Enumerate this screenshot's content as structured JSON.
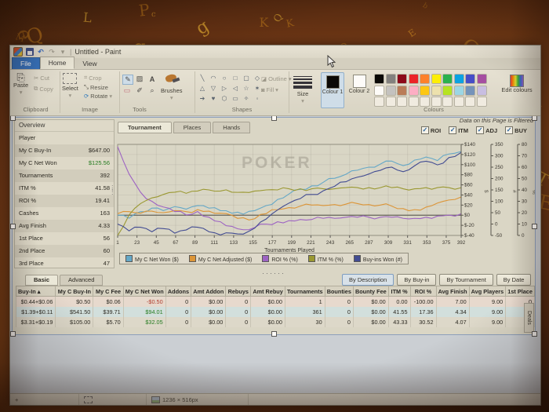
{
  "wallpaper": {
    "letters": "aQbjREsTuVwXyZkLmNoPdFgHiJcK3e97BDGMWqrzABCdefgHIJ"
  },
  "paint": {
    "title": "Untitled - Paint",
    "tabs": [
      "File",
      "Home",
      "View"
    ],
    "ribbon": {
      "clipboard": {
        "label": "Clipboard",
        "paste": "Paste",
        "cut": "Cut",
        "copy": "Copy"
      },
      "image": {
        "label": "Image",
        "select": "Select",
        "crop": "Crop",
        "resize": "Resize",
        "rotate": "Rotate"
      },
      "tools": {
        "label": "Tools",
        "brushes": "Brushes"
      },
      "shapes": {
        "label": "Shapes",
        "outline": "Outline",
        "fill": "Fill"
      },
      "size_label": "Size",
      "colours": {
        "label": "Colours",
        "colour1": "Colour 1",
        "colour2": "Colour 2",
        "edit": "Edit colours",
        "palette_row1": [
          "#000000",
          "#7f7f7f",
          "#880015",
          "#ed1c24",
          "#ff7f27",
          "#fff200",
          "#22b14c",
          "#00a2e8",
          "#3f48cc",
          "#a349a4"
        ],
        "palette_row2": [
          "#ffffff",
          "#c3c3c3",
          "#b97a57",
          "#ffaec9",
          "#ffc90e",
          "#efe4b0",
          "#b5e61d",
          "#99d9ea",
          "#7092be",
          "#c8bfe7"
        ],
        "palette_empty": "#f2efe6"
      }
    },
    "status": {
      "image_size": "1236 × 516px"
    }
  },
  "poker": {
    "overview": {
      "title": "Overview",
      "rows": [
        {
          "label": "Player",
          "value": ""
        },
        {
          "label": "My C Buy-In",
          "value": "$647.00"
        },
        {
          "label": "My C Net Won",
          "value": "$125.56",
          "color": "#1e7a1e"
        },
        {
          "label": "Tournaments",
          "value": "392"
        },
        {
          "label": "ITM %",
          "value": "41.58"
        },
        {
          "label": "ROI %",
          "value": "19.41"
        },
        {
          "label": "Cashes",
          "value": "163"
        },
        {
          "label": "Avg Finish",
          "value": "4.33"
        },
        {
          "label": "1st Place",
          "value": "56"
        },
        {
          "label": "2nd Place",
          "value": "60"
        },
        {
          "label": "3rd Place",
          "value": "47"
        }
      ]
    },
    "view_tabs": [
      "Tournament",
      "Places",
      "Hands"
    ],
    "filter_note": "Data on this Page is Filtered",
    "filters": [
      "ROI",
      "ITM",
      "ADJ",
      "BUY"
    ],
    "chart_data": {
      "type": "line",
      "title": "",
      "xlabel": "Tournaments Played",
      "x_range": [
        1,
        392
      ],
      "x_ticks": [
        1,
        23,
        45,
        67,
        89,
        111,
        133,
        155,
        177,
        199,
        221,
        243,
        265,
        287,
        309,
        331,
        353,
        375,
        392
      ],
      "grid": true,
      "legend_position": "bottom",
      "watermark": "POKER",
      "axes": [
        {
          "id": "dollar",
          "unit": "$",
          "range": [
            -40,
            140
          ],
          "ticks": [
            "$140",
            "$120",
            "$100",
            "$80",
            "$60",
            "$40",
            "$20",
            "$0",
            "$-20",
            "$-40"
          ]
        },
        {
          "id": "count",
          "unit": "#",
          "range": [
            -50,
            350
          ],
          "ticks": [
            "350",
            "300",
            "250",
            "200",
            "150",
            "100",
            "50",
            "0",
            "-50"
          ]
        },
        {
          "id": "percent",
          "unit": "%",
          "range": [
            0,
            80
          ],
          "ticks": [
            "80",
            "70",
            "60",
            "50",
            "40",
            "30",
            "20",
            "10",
            "0"
          ]
        }
      ],
      "x_sample": [
        1,
        14,
        27,
        40,
        53,
        66,
        79,
        92,
        105,
        118,
        131,
        144,
        157,
        170,
        183,
        196,
        209,
        222,
        235,
        248,
        261,
        274,
        287,
        300,
        313,
        326,
        339,
        352,
        365,
        378,
        392
      ],
      "series": [
        {
          "name": "My C Net Won ($)",
          "axis": "dollar",
          "color": "#5fa8cc",
          "values": [
            0,
            -6,
            7,
            14,
            9,
            17,
            12,
            19,
            14,
            9,
            4,
            2,
            9,
            19,
            31,
            42,
            51,
            58,
            65,
            73,
            81,
            89,
            95,
            101,
            107,
            98,
            109,
            115,
            108,
            121,
            126
          ]
        },
        {
          "name": "My C Net Adjusted ($)",
          "axis": "dollar",
          "color": "#dd9434",
          "values": [
            3,
            7,
            4,
            8,
            5,
            9,
            7,
            11,
            8,
            4,
            0,
            -5,
            -7,
            3,
            11,
            15,
            18,
            20,
            19,
            21,
            22,
            23,
            21,
            20,
            18,
            13,
            11,
            16,
            24,
            30,
            36
          ]
        },
        {
          "name": "ROI % (%)",
          "axis": "percent",
          "color": "#9a5fc8",
          "values": [
            78,
            54,
            38,
            30,
            25,
            21,
            18,
            21,
            16,
            12,
            8,
            5,
            7,
            10,
            12,
            13,
            14,
            14,
            15,
            15,
            16,
            16,
            16,
            16,
            16,
            15,
            15,
            16,
            17,
            18,
            19
          ]
        },
        {
          "name": "ITM % (%)",
          "axis": "percent",
          "color": "#97972e",
          "values": [
            0,
            18,
            28,
            33,
            36,
            38,
            37,
            39,
            40,
            39,
            38,
            38,
            39,
            40,
            40,
            41,
            41,
            41,
            41,
            41,
            42,
            42,
            42,
            42,
            42,
            41,
            41,
            42,
            42,
            42,
            42
          ]
        },
        {
          "name": "Buy-ins Won (#)",
          "axis": "count",
          "color": "#3a4794",
          "values": [
            0,
            -30,
            -14,
            -34,
            -20,
            -40,
            -26,
            -14,
            -34,
            -48,
            -40,
            -44,
            -18,
            22,
            62,
            92,
            112,
            130,
            146,
            166,
            186,
            206,
            220,
            236,
            250,
            230,
            256,
            276,
            260,
            292,
            315
          ]
        }
      ]
    },
    "bottom": {
      "tabs": [
        "Basic",
        "Advanced"
      ],
      "group_buttons": [
        "By Description",
        "By Buy-in",
        "By Tournament",
        "By Date"
      ],
      "deals_tab": "Deals"
    },
    "table": {
      "columns": [
        "Buy-In",
        "My C Buy-In",
        "My C Fee",
        "My C Net Won",
        "Addons",
        "Amt Addon",
        "Rebuys",
        "Amt Rebuy",
        "Tournaments",
        "Bounties",
        "Bounty Fee",
        "ITM %",
        "ROI %",
        "Avg Finish",
        "Avg Players",
        "1st Place"
      ],
      "rows": [
        [
          "$0.44+$0.06",
          "$0.50",
          "$0.06",
          "-$0.50",
          "0",
          "$0.00",
          "0",
          "$0.00",
          "1",
          "0",
          "$0.00",
          "0.00",
          "-100.00",
          "7.00",
          "9.00",
          "0"
        ],
        [
          "$1.39+$0.11",
          "$541.50",
          "$39.71",
          "$94.01",
          "0",
          "$0.00",
          "0",
          "$0.00",
          "361",
          "0",
          "$0.00",
          "41.55",
          "17.36",
          "4.34",
          "9.00",
          "51"
        ],
        [
          "$3.31+$0.19",
          "$105.00",
          "$5.70",
          "$32.05",
          "0",
          "$0.00",
          "0",
          "$0.00",
          "30",
          "0",
          "$0.00",
          "43.33",
          "30.52",
          "4.07",
          "9.00",
          "5"
        ]
      ],
      "net_won_colors": [
        "#b03a2e",
        "#1e7a1e",
        "#1e7a1e"
      ]
    }
  }
}
